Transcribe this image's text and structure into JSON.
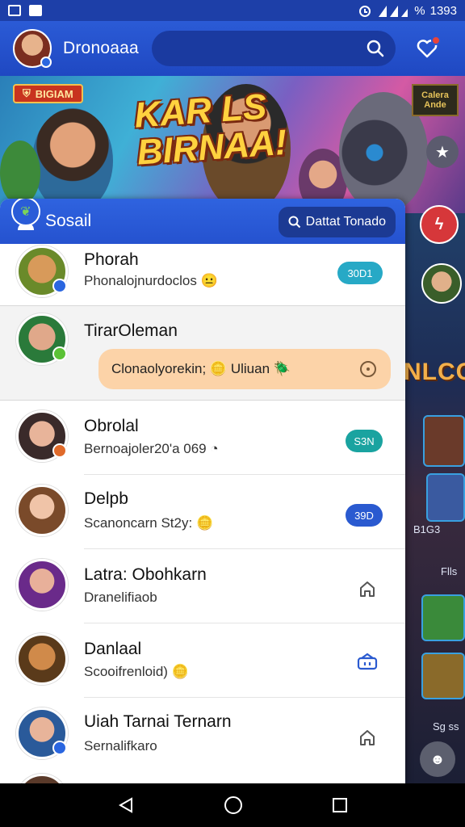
{
  "status_bar": {
    "battery": "%",
    "time": "1393"
  },
  "header": {
    "title": "Dronoaaa",
    "search_placeholder": "",
    "has_notification": true
  },
  "banner": {
    "badge": "BIGIAM",
    "title_line1": "KAR  LS",
    "title_line2": "BIRNAA!",
    "logo_text": "Calera Ande"
  },
  "social": {
    "title": "Sosail",
    "action_button": "Dattat Tonado"
  },
  "friends": [
    {
      "name": "Phorah",
      "status": "Phonalojnurdoclos",
      "emoji": "😐",
      "pill": "30D1",
      "pill_color": "#27a9c6",
      "badge_color": "#2a66e0"
    },
    {
      "name": "TirarOleman",
      "status": "",
      "bubble": "Clonaolyorekin;",
      "bubble_emoji": "🪙",
      "bubble_tail": "Uliuan",
      "bubble_tail_emoji": "🪲",
      "badge_color": "#5bc236"
    },
    {
      "name": "Obrolal",
      "status": "Bernoajoler20'a 069",
      "pill": "S3N",
      "pill_color": "#1aa3a0",
      "badge_color": "#e06a2a"
    },
    {
      "name": "Delpb",
      "status": "Scanoncarn St2y:",
      "emoji": "🪙",
      "pill": "39D",
      "pill_color": "#2a5ad0",
      "badge_color": ""
    },
    {
      "name": "Latra: Obohkarn",
      "status": "Dranelifiaob",
      "icon": "house-icon",
      "badge_color": ""
    },
    {
      "name": "Danlaal",
      "status": "Scooifrenloid)",
      "emoji": "🪙",
      "icon": "gift-icon",
      "badge_color": ""
    },
    {
      "name": "Uiah Tarnai Ternarn",
      "status": "Sernalifkaro",
      "icon": "house-icon",
      "badge_color": "#2a66e0"
    }
  ],
  "side": {
    "big_text": "NLCO",
    "label1": "B1G3",
    "label2": "Flls",
    "label3": "Sg ss"
  },
  "colors": {
    "primary": "#2552cf",
    "accent_red": "#d6373a",
    "bubble": "#fcd3a8"
  }
}
